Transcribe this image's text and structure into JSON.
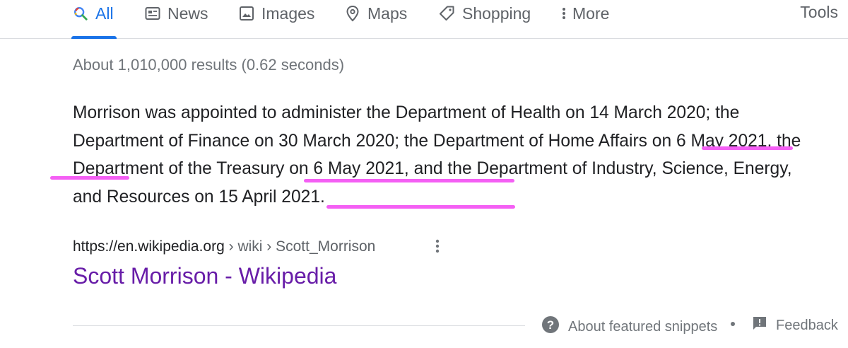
{
  "tabs": [
    {
      "label": "All",
      "icon": "search-icon",
      "active": true
    },
    {
      "label": "News",
      "icon": "news-icon"
    },
    {
      "label": "Images",
      "icon": "image-icon"
    },
    {
      "label": "Maps",
      "icon": "map-pin-icon"
    },
    {
      "label": "Shopping",
      "icon": "tag-icon"
    },
    {
      "label": "More",
      "icon": "more-vert-icon"
    }
  ],
  "tools_label": "Tools",
  "result_stats": "About 1,010,000 results (0.62 seconds)",
  "snippet": {
    "text": "Morrison was appointed to administer the Department of Health on 14 March 2020; the Department of Finance on 30 March 2020; the Department of Home Affairs on 6 May 2021, the Department of the Treasury on 6 May 2021, and the Department of Industry, Science, Energy, and Resources on 15 April 2021."
  },
  "result": {
    "url_domain": "https://en.wikipedia.org",
    "url_path": " › wiki › Scott_Morrison",
    "title": "Scott Morrison - Wikipedia"
  },
  "footer": {
    "about_label": "About featured snippets",
    "feedback_label": "Feedback"
  },
  "colors": {
    "accent": "#1a73e8",
    "visited_link": "#681da8",
    "highlight": "#f45ff4",
    "muted": "#70757a"
  }
}
